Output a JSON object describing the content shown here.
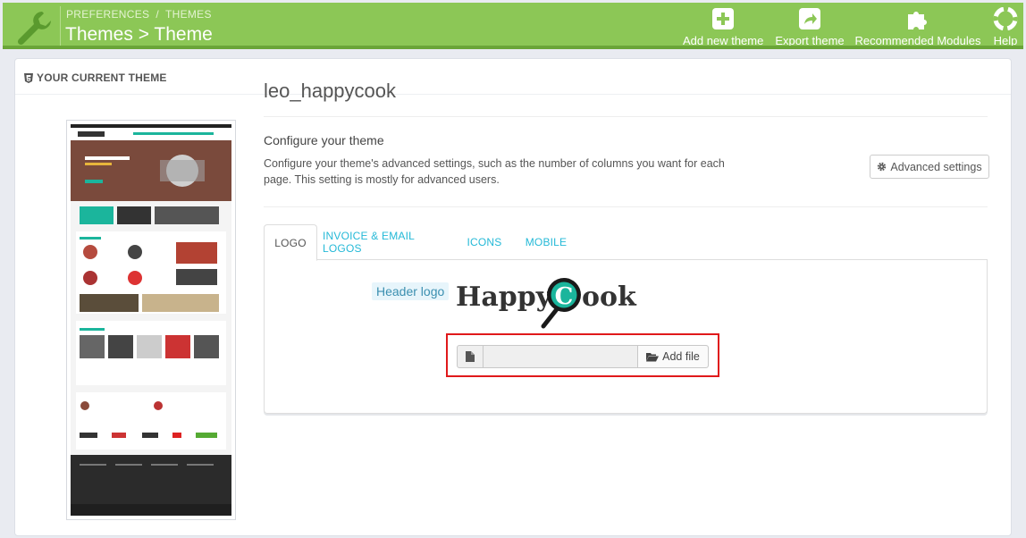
{
  "header": {
    "breadcrumb": [
      "PREFERENCES",
      "THEMES"
    ],
    "breadcrumb_separator": "/",
    "title": "Themes > Theme",
    "color": "#8cc756",
    "toolbar": [
      {
        "label": "Add new theme",
        "icon": "plus-square-icon"
      },
      {
        "label": "Export theme",
        "icon": "share-arrow-icon"
      },
      {
        "label": "Recommended Modules",
        "icon": "puzzle-icon"
      },
      {
        "label": "Help",
        "icon": "lifebuoy-icon"
      }
    ]
  },
  "panel": {
    "heading": "YOUR CURRENT THEME",
    "heading_icon": "html5-icon"
  },
  "theme": {
    "name": "leo_happycook",
    "configure_title": "Configure your theme",
    "configure_desc": "Configure your theme's advanced settings, such as the number of columns you want for each page. This setting is mostly for advanced users.",
    "advanced_button": "Advanced settings"
  },
  "tabs": [
    {
      "label": "LOGO",
      "active": true
    },
    {
      "label": "INVOICE & EMAIL LOGOS",
      "active": false
    },
    {
      "label": "ICONS",
      "active": false
    },
    {
      "label": "MOBILE",
      "active": false
    }
  ],
  "logo_tab": {
    "label": "Header logo",
    "logo_text_left": "Happy",
    "logo_letter": "C",
    "logo_text_right": "ook",
    "add_file_button": "Add file",
    "file_value": ""
  },
  "colors": {
    "accent": "#25b9d7",
    "logo_teal": "#1bb59c",
    "highlight_box": "#e0191b"
  }
}
